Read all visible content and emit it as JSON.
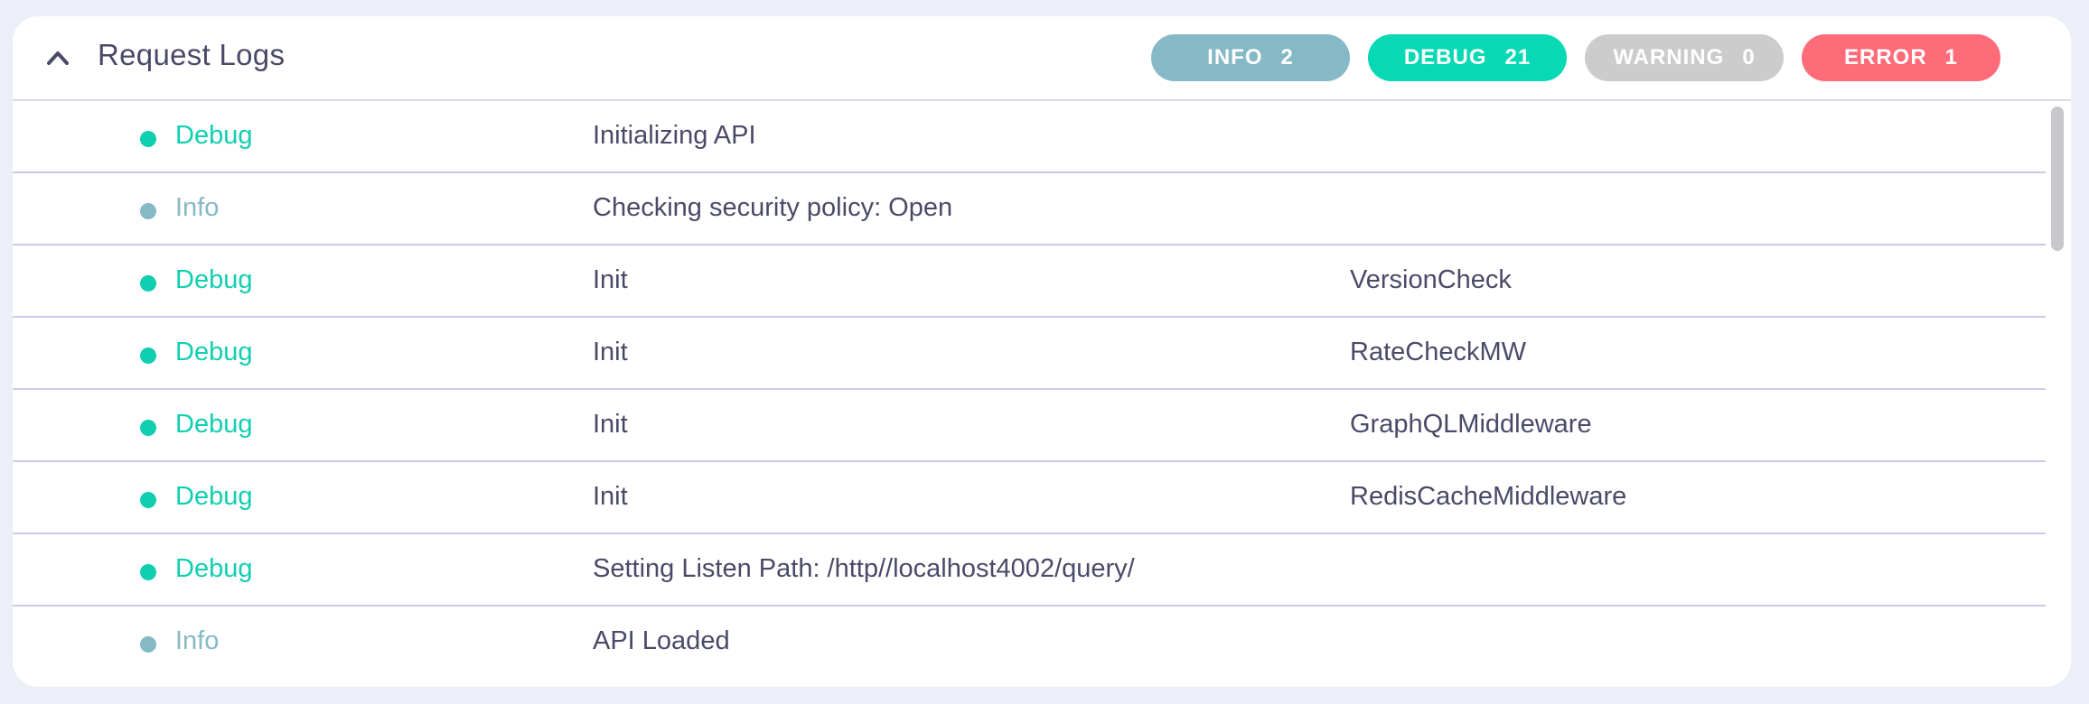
{
  "panel": {
    "title": "Request Logs",
    "collapse_icon": "chevron-up-icon"
  },
  "filters": [
    {
      "label": "INFO",
      "count": "2",
      "color": "#86b9c6"
    },
    {
      "label": "DEBUG",
      "count": "21",
      "color": "#07d9b4"
    },
    {
      "label": "WARNING",
      "count": "0",
      "color": "#cccccc"
    },
    {
      "label": "ERROR",
      "count": "1",
      "color": "#fe6b79"
    }
  ],
  "level_colors": {
    "Debug": "#10cfb0",
    "Info": "#86b9c6"
  },
  "logs": [
    {
      "level": "Debug",
      "message": "Initializing API",
      "extra": ""
    },
    {
      "level": "Info",
      "message": "Checking security policy: Open",
      "extra": ""
    },
    {
      "level": "Debug",
      "message": "Init",
      "extra": "VersionCheck"
    },
    {
      "level": "Debug",
      "message": "Init",
      "extra": "RateCheckMW"
    },
    {
      "level": "Debug",
      "message": "Init",
      "extra": "GraphQLMiddleware"
    },
    {
      "level": "Debug",
      "message": "Init",
      "extra": "RedisCacheMiddleware"
    },
    {
      "level": "Debug",
      "message": "Setting Listen Path: /http//localhost4002/query/",
      "extra": ""
    },
    {
      "level": "Info",
      "message": "API Loaded",
      "extra": ""
    }
  ]
}
